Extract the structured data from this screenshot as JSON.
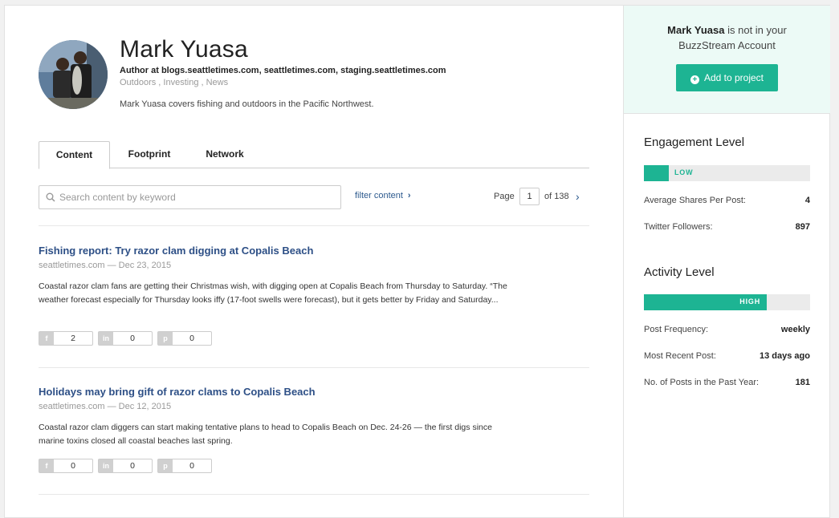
{
  "profile": {
    "name": "Mark Yuasa",
    "author_line": "Author at blogs.seattletimes.com, seattletimes.com, staging.seattletimes.com",
    "tags": "Outdoors , Investing , News",
    "bio": "Mark Yuasa covers fishing and outdoors in the Pacific Northwest."
  },
  "tabs": [
    {
      "label": "Content",
      "active": true
    },
    {
      "label": "Footprint",
      "active": false
    },
    {
      "label": "Network",
      "active": false
    }
  ],
  "search": {
    "placeholder": "Search content by keyword",
    "value": ""
  },
  "filter_label": "filter content",
  "pager": {
    "page_label": "Page",
    "current": "1",
    "of_label": "of 138"
  },
  "posts": [
    {
      "title": "Fishing report: Try razor clam digging at Copalis Beach",
      "meta": "seattletimes.com — Dec 23, 2015",
      "excerpt": "Coastal razor clam fans are getting their Christmas wish, with digging open at Copalis Beach from Thursday to Saturday. “The weather forecast especially for Thursday looks iffy (17-foot swells were forecast), but it gets better by Friday and Saturday...",
      "shares": {
        "facebook": "2",
        "linkedin": "0",
        "pinterest": "0"
      }
    },
    {
      "title": "Holidays may bring gift of razor clams to Copalis Beach",
      "meta": "seattletimes.com — Dec 12, 2015",
      "excerpt": "Coastal razor clam diggers can start making tentative plans to head to Copalis Beach on Dec. 24-26 — the first digs since marine toxins closed all coastal beaches last spring.",
      "shares": {
        "facebook": "0",
        "linkedin": "0",
        "pinterest": "0"
      }
    }
  ],
  "share_icons": {
    "facebook": "f",
    "linkedin": "in",
    "pinterest": "p"
  },
  "account": {
    "name": "Mark Yuasa",
    "msg_rest": "is not in your",
    "msg_line2": "BuzzStream Account",
    "add_button": "Add to project"
  },
  "engagement": {
    "title": "Engagement Level",
    "level": "LOW",
    "level_fraction": 0.15,
    "stats": [
      {
        "label": "Average Shares Per Post:",
        "value": "4"
      },
      {
        "label": "Twitter Followers:",
        "value": "897"
      }
    ]
  },
  "activity": {
    "title": "Activity Level",
    "level": "HIGH",
    "level_fraction": 0.74,
    "stats": [
      {
        "label": "Post Frequency:",
        "value": "weekly"
      },
      {
        "label": "Most Recent Post:",
        "value": "13 days ago"
      },
      {
        "label": "No. of Posts in the Past Year:",
        "value": "181"
      }
    ]
  },
  "colors": {
    "accent": "#1db493",
    "link": "#2d4f86",
    "panel": "#ecfaf6"
  }
}
